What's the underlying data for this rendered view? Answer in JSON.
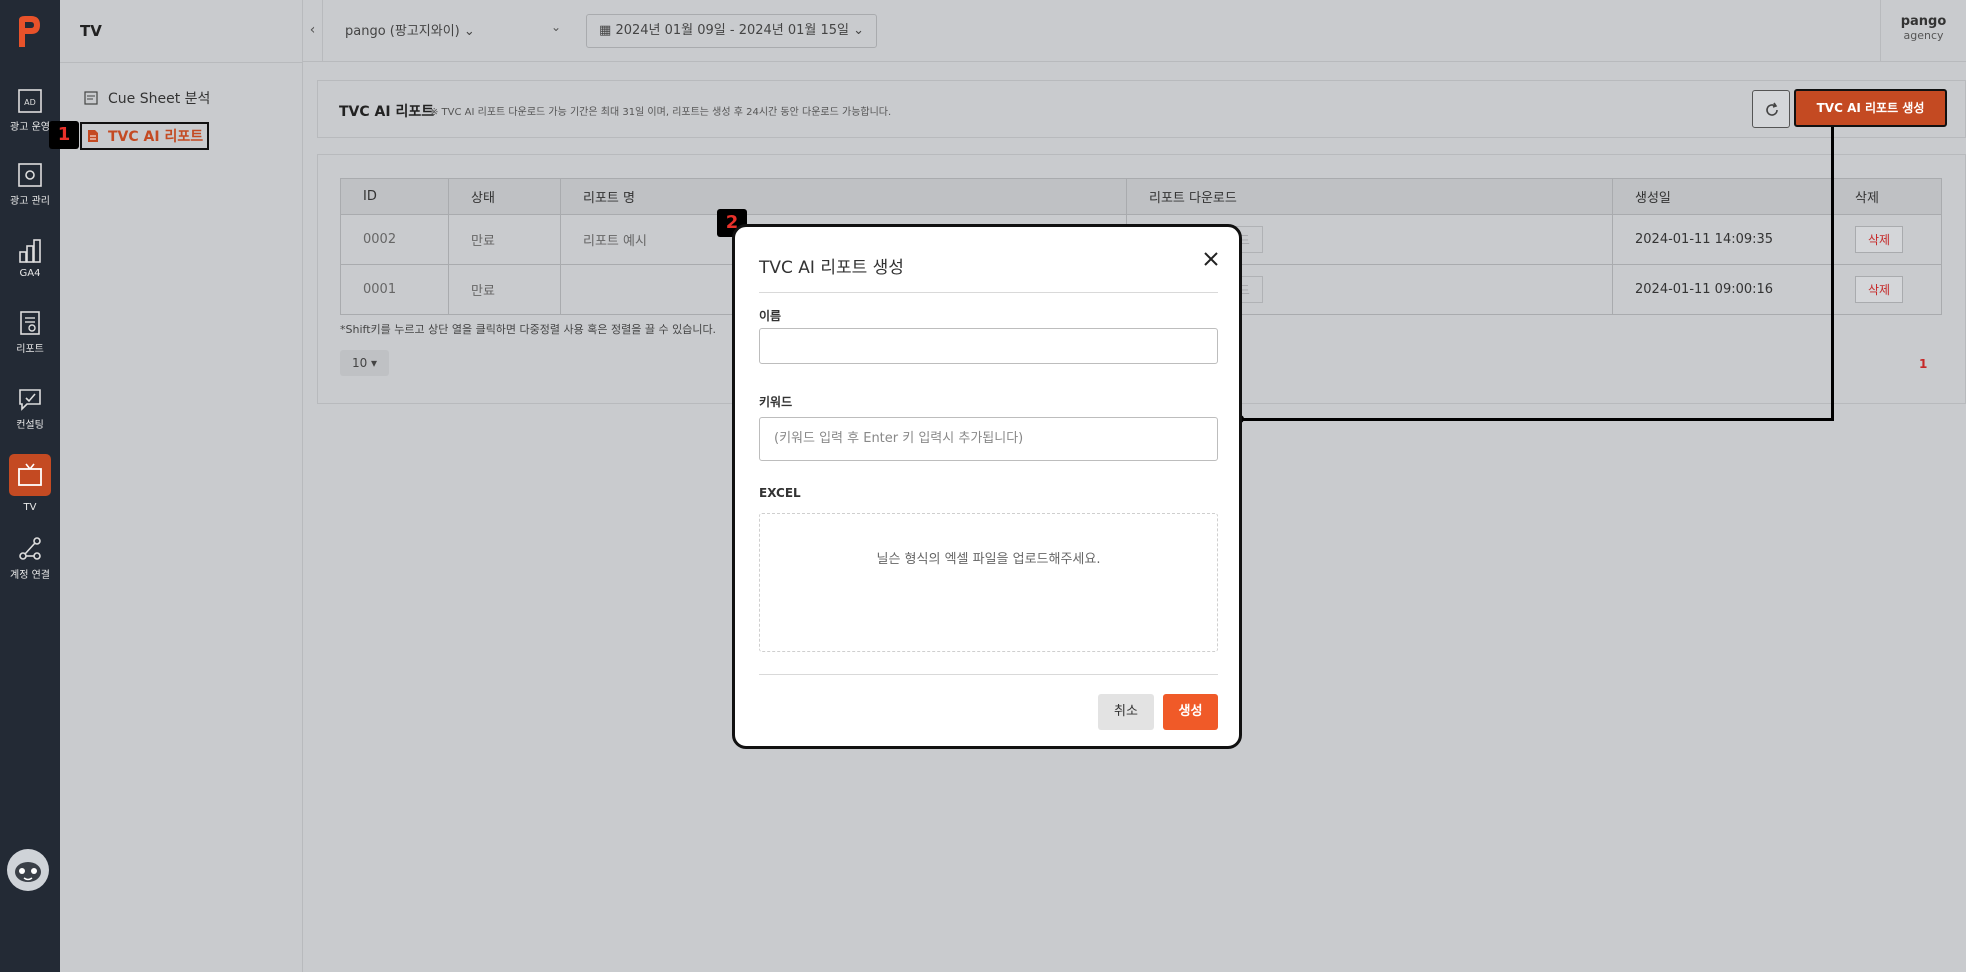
{
  "rail": {
    "items": [
      {
        "label": "광고 운영",
        "icon": "ad-icon"
      },
      {
        "label": "광고 관리",
        "icon": "ad-settings-icon"
      },
      {
        "label": "GA4",
        "icon": "bar-chart-icon"
      },
      {
        "label": "리포트",
        "icon": "report-icon"
      },
      {
        "label": "컨설팅",
        "icon": "consulting-icon"
      },
      {
        "label": "TV",
        "icon": "tv-icon"
      },
      {
        "label": "계정 연결",
        "icon": "share-icon"
      }
    ]
  },
  "sidebar": {
    "title": "TV",
    "items": [
      {
        "label": "Cue Sheet 분석"
      },
      {
        "label": "TVC AI 리포트"
      }
    ]
  },
  "markers": {
    "one": "1",
    "two": "2"
  },
  "topbar": {
    "account": "pango (팡고지와이)",
    "date_range": "2024년 01월 09일 - 2024년 01월 15일",
    "user_name": "pango",
    "user_role": "agency"
  },
  "header": {
    "title": "TVC AI 리포트",
    "note": "※ TVC AI 리포트 다운로드 가능 기간은 최대 31일 이며, 리포트는 생성 후 24시간 동안 다운로드 가능합니다.",
    "create_label": "TVC AI 리포트 생성"
  },
  "table": {
    "columns": [
      "ID",
      "상태",
      "리포트 명",
      "리포트 다운로드",
      "생성일",
      "삭제"
    ],
    "rows": [
      {
        "id": "0002",
        "status": "만료",
        "name": "리포트 예시",
        "download": "Report 다운로드",
        "created": "2024-01-11 14:09:35",
        "delete": "삭제"
      },
      {
        "id": "0001",
        "status": "만료",
        "name": "",
        "download": "Report 다운로드",
        "created": "2024-01-11 09:00:16",
        "delete": "삭제"
      }
    ],
    "hint": "*Shift키를 누르고 상단 열을 클릭하면 다중정렬 사용 혹은 정렬을 끌 수 있습니다.",
    "page_size": "10",
    "page": "1"
  },
  "modal": {
    "title": "TVC AI 리포트 생성",
    "name_label": "이름",
    "name_value": "",
    "keyword_label": "키워드",
    "keyword_placeholder": "(키워드 입력 후 Enter 키 입력시 추가됩니다)",
    "excel_label": "EXCEL",
    "excel_hint": "닐슨 형식의 엑셀 파일을 업로드해주세요.",
    "cancel_label": "취소",
    "submit_label": "생성"
  },
  "colors": {
    "accent": "#c44a22",
    "submit": "#f05a28",
    "rail_bg": "#232a35",
    "delete_text": "#c62828"
  }
}
